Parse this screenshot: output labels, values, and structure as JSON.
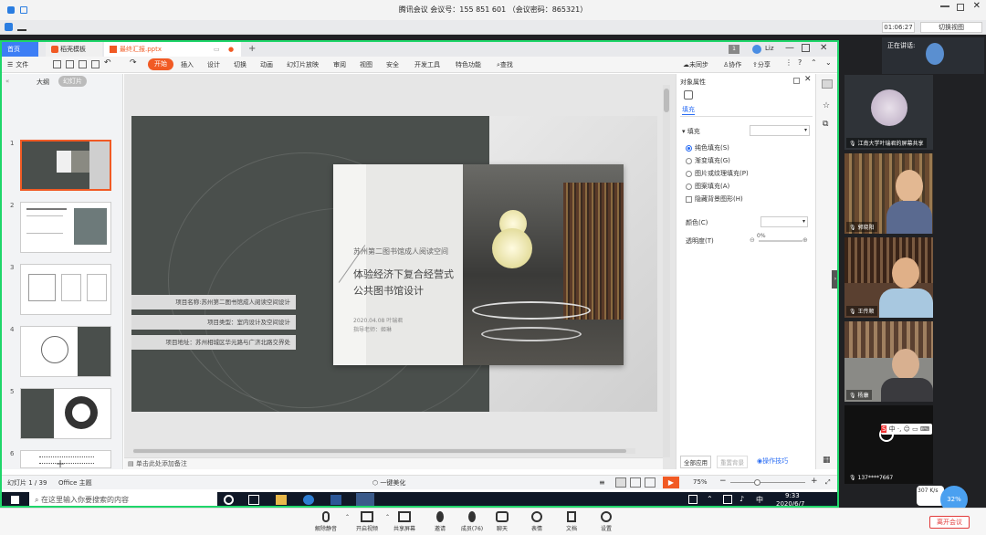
{
  "meeting": {
    "title": "腾讯会议 会议号：155 851 601 （会议密码：865321）",
    "timer": "01:06:27",
    "switch_view": "切换视图",
    "speaking": "正在讲话:",
    "leave": "离开会议",
    "net_speed": "307 K/s",
    "net_pct": "32%"
  },
  "tabs": {
    "home": "首页",
    "template": "稻壳模板",
    "file": "最终汇报.pptx",
    "user": "Liz"
  },
  "ribbon": {
    "file": "文件",
    "start": "开始",
    "menus": [
      "插入",
      "设计",
      "切换",
      "动画",
      "幻灯片放映",
      "审阅",
      "视图",
      "安全",
      "开发工具",
      "特色功能"
    ],
    "search": "查找",
    "sync": "未同步",
    "collab": "协作",
    "share": "分享"
  },
  "left": {
    "outline": "大纲",
    "slides": "幻灯片",
    "nums": [
      "1",
      "2",
      "3",
      "4",
      "5",
      "6"
    ]
  },
  "slide": {
    "title_small": "苏州第二图书馆成人阅读空间",
    "title_line1": "体验经济下复合经营式",
    "title_line2": "公共图书馆设计",
    "date_author": "2020.04.08 叶瑞君",
    "advisor": "指导老师：姬琳",
    "info": [
      "项目名称:苏州第二图书馆成人阅读空间设计",
      "项目类型：室内设计及空间设计",
      "项目地址：苏州相城区华元路与广济北路交界处"
    ]
  },
  "notes": "单击此处添加备注",
  "pane": {
    "title": "对象属性",
    "fill_tab": "填充",
    "fill_section": "填充",
    "options": [
      "纯色填充(S)",
      "渐变填充(G)",
      "图片或纹理填充(P)",
      "图案填充(A)"
    ],
    "hide_bg": "隐藏背景图形(H)",
    "color": "颜色(C)",
    "transparency": "透明度(T)",
    "transparency_val": "0%",
    "apply_all": "全部应用",
    "reset_bg": "重置背景",
    "tips": "操作技巧"
  },
  "status": {
    "slide_count": "幻灯片 1 / 39",
    "theme": "Office 主题",
    "beautify": "一键美化",
    "zoom": "75%"
  },
  "taskbar": {
    "search": "在这里输入你要搜索的内容",
    "time": "9:33",
    "date": "2020/6/7"
  },
  "participants": [
    {
      "name": "江南大学叶瑞君的屏幕共享"
    },
    {
      "name": "郭晓阳"
    },
    {
      "name": "王传顺"
    },
    {
      "name": "杨康"
    },
    {
      "name": "137****7667"
    }
  ],
  "toolbar": {
    "mute": "解除静音",
    "video": "开启视频",
    "share": "共享屏幕",
    "invite": "邀请",
    "members": "成员(76)",
    "chat": "聊天",
    "emoji": "表情",
    "docs": "文档",
    "settings": "设置"
  },
  "colors": {
    "accent_green": "#1fd66a",
    "wps_orange": "#f15a24",
    "leave_red": "#e23b3b"
  }
}
